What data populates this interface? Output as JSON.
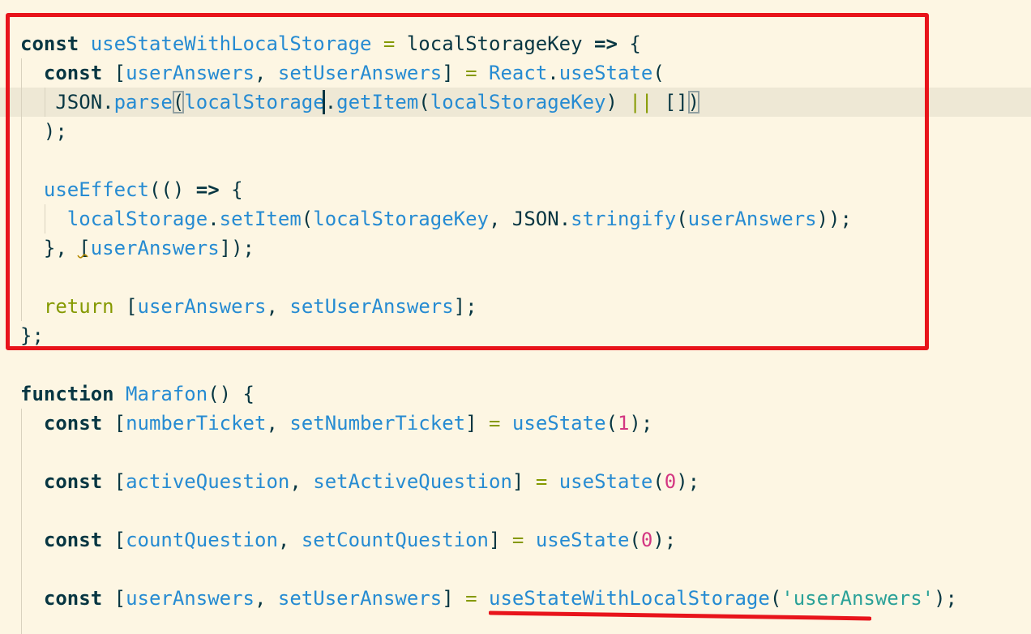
{
  "code": {
    "lines": [
      [
        [
          "kw",
          "const "
        ],
        [
          "fn",
          "useStateWithLocalStorage"
        ],
        [
          "op",
          " = "
        ],
        [
          "pl",
          "localStorageKey "
        ],
        [
          "kw",
          "=>"
        ],
        [
          "pl",
          " {"
        ]
      ],
      [
        [
          "pl",
          "  "
        ],
        [
          "kw",
          "const "
        ],
        [
          "pl",
          "["
        ],
        [
          "fn",
          "userAnswers"
        ],
        [
          "pl",
          ", "
        ],
        [
          "fn",
          "setUserAnswers"
        ],
        [
          "pl",
          "] "
        ],
        [
          "op",
          "="
        ],
        [
          "pl",
          " "
        ],
        [
          "fn",
          "React"
        ],
        [
          "pl",
          "."
        ],
        [
          "fn",
          "useState"
        ],
        [
          "pl",
          "("
        ]
      ],
      [
        [
          "pl",
          "   JSON."
        ],
        [
          "fn",
          "parse"
        ],
        [
          "bm",
          "("
        ],
        [
          "fn",
          "localStorage"
        ],
        [
          "pl",
          "."
        ],
        [
          "fn",
          "getItem"
        ],
        [
          "pl",
          "("
        ],
        [
          "fn",
          "localStorageKey"
        ],
        [
          "pl",
          ") "
        ],
        [
          "op",
          "||"
        ],
        [
          "pl",
          " []"
        ],
        [
          "bm",
          ")"
        ]
      ],
      [
        [
          "pl",
          "  );"
        ]
      ],
      [],
      [
        [
          "pl",
          "  "
        ],
        [
          "fn",
          "useEffect"
        ],
        [
          "pl",
          "(() "
        ],
        [
          "kw",
          "=>"
        ],
        [
          "pl",
          " {"
        ]
      ],
      [
        [
          "pl",
          "    "
        ],
        [
          "fn",
          "localStorage"
        ],
        [
          "pl",
          "."
        ],
        [
          "fn",
          "setItem"
        ],
        [
          "pl",
          "("
        ],
        [
          "fn",
          "localStorageKey"
        ],
        [
          "pl",
          ", JSON."
        ],
        [
          "fn",
          "stringify"
        ],
        [
          "pl",
          "("
        ],
        [
          "fn",
          "userAnswers"
        ],
        [
          "pl",
          "));"
        ]
      ],
      [
        [
          "pl",
          "  }, ["
        ],
        [
          "fn",
          "userAnswers"
        ],
        [
          "pl",
          "]);"
        ]
      ],
      [],
      [
        [
          "pl",
          "  "
        ],
        [
          "ret",
          "return"
        ],
        [
          "pl",
          " ["
        ],
        [
          "fn",
          "userAnswers"
        ],
        [
          "pl",
          ", "
        ],
        [
          "fn",
          "setUserAnswers"
        ],
        [
          "pl",
          "];"
        ]
      ],
      [
        [
          "pl",
          "};"
        ]
      ],
      [],
      [
        [
          "kw",
          "function "
        ],
        [
          "fn",
          "Marafon"
        ],
        [
          "pl",
          "() {"
        ]
      ],
      [
        [
          "pl",
          "  "
        ],
        [
          "kw",
          "const "
        ],
        [
          "pl",
          "["
        ],
        [
          "fn",
          "numberTicket"
        ],
        [
          "pl",
          ", "
        ],
        [
          "fn",
          "setNumberTicket"
        ],
        [
          "pl",
          "] "
        ],
        [
          "op",
          "="
        ],
        [
          "pl",
          " "
        ],
        [
          "fn",
          "useState"
        ],
        [
          "pl",
          "("
        ],
        [
          "num",
          "1"
        ],
        [
          "pl",
          ");"
        ]
      ],
      [],
      [
        [
          "pl",
          "  "
        ],
        [
          "kw",
          "const "
        ],
        [
          "pl",
          "["
        ],
        [
          "fn",
          "activeQuestion"
        ],
        [
          "pl",
          ", "
        ],
        [
          "fn",
          "setActiveQuestion"
        ],
        [
          "pl",
          "] "
        ],
        [
          "op",
          "="
        ],
        [
          "pl",
          " "
        ],
        [
          "fn",
          "useState"
        ],
        [
          "pl",
          "("
        ],
        [
          "num",
          "0"
        ],
        [
          "pl",
          ");"
        ]
      ],
      [],
      [
        [
          "pl",
          "  "
        ],
        [
          "kw",
          "const "
        ],
        [
          "pl",
          "["
        ],
        [
          "fn",
          "countQuestion"
        ],
        [
          "pl",
          ", "
        ],
        [
          "fn",
          "setCountQuestion"
        ],
        [
          "pl",
          "] "
        ],
        [
          "op",
          "="
        ],
        [
          "pl",
          " "
        ],
        [
          "fn",
          "useState"
        ],
        [
          "pl",
          "("
        ],
        [
          "num",
          "0"
        ],
        [
          "pl",
          ");"
        ]
      ],
      [],
      [
        [
          "pl",
          "  "
        ],
        [
          "kw",
          "const "
        ],
        [
          "pl",
          "["
        ],
        [
          "fn",
          "userAnswers"
        ],
        [
          "pl",
          ", "
        ],
        [
          "fn",
          "setUserAnswers"
        ],
        [
          "pl",
          "] "
        ],
        [
          "op",
          "="
        ],
        [
          "pl",
          " "
        ],
        [
          "fn",
          "useStateWithLocalStorage"
        ],
        [
          "pl",
          "("
        ],
        [
          "str",
          "'userAnswers'"
        ],
        [
          "pl",
          ");"
        ]
      ]
    ],
    "current_line": 2
  },
  "colors": {
    "background": "#fdf6e3",
    "current_line": "#eee8d5",
    "keyword": "#073642",
    "identifier": "#268bd2",
    "operator": "#859900",
    "number": "#d33682",
    "string": "#2aa198",
    "annotation_red": "#e8141b"
  }
}
